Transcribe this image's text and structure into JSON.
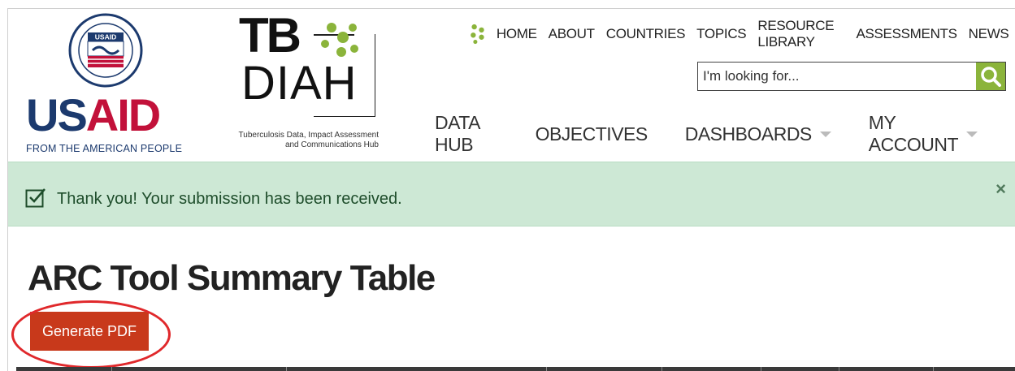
{
  "header": {
    "usaid": {
      "word_us": "US",
      "word_aid": "AID",
      "tagline": "FROM THE AMERICAN PEOPLE",
      "seal_text": "USAID"
    },
    "tbdiah": {
      "word_tb": "TB",
      "word_diah": "DIAH",
      "tagline_line1": "Tuberculosis Data, Impact Assessment",
      "tagline_line2": "and Communications Hub"
    },
    "top_nav": [
      "HOME",
      "ABOUT",
      "COUNTRIES",
      "TOPICS",
      "RESOURCE LIBRARY",
      "ASSESSMENTS",
      "NEWS"
    ],
    "search": {
      "placeholder": "I'm looking for..."
    },
    "main_nav": [
      {
        "label": "DATA HUB"
      },
      {
        "label": "OBJECTIVES"
      },
      {
        "label": "DASHBOARDS"
      },
      {
        "label": "MY ACCOUNT"
      }
    ]
  },
  "alert": {
    "message": "Thank you! Your submission has been received.",
    "close_symbol": "×"
  },
  "page": {
    "title": "ARC Tool Summary Table",
    "generate_pdf_label": "Generate PDF"
  },
  "colors": {
    "usaid_blue": "#1c3a6e",
    "usaid_red": "#c2113a",
    "brand_green": "#8bb43b",
    "alert_bg": "#cde8d5",
    "button_red": "#c8391b",
    "highlight_red": "#e0282b"
  }
}
